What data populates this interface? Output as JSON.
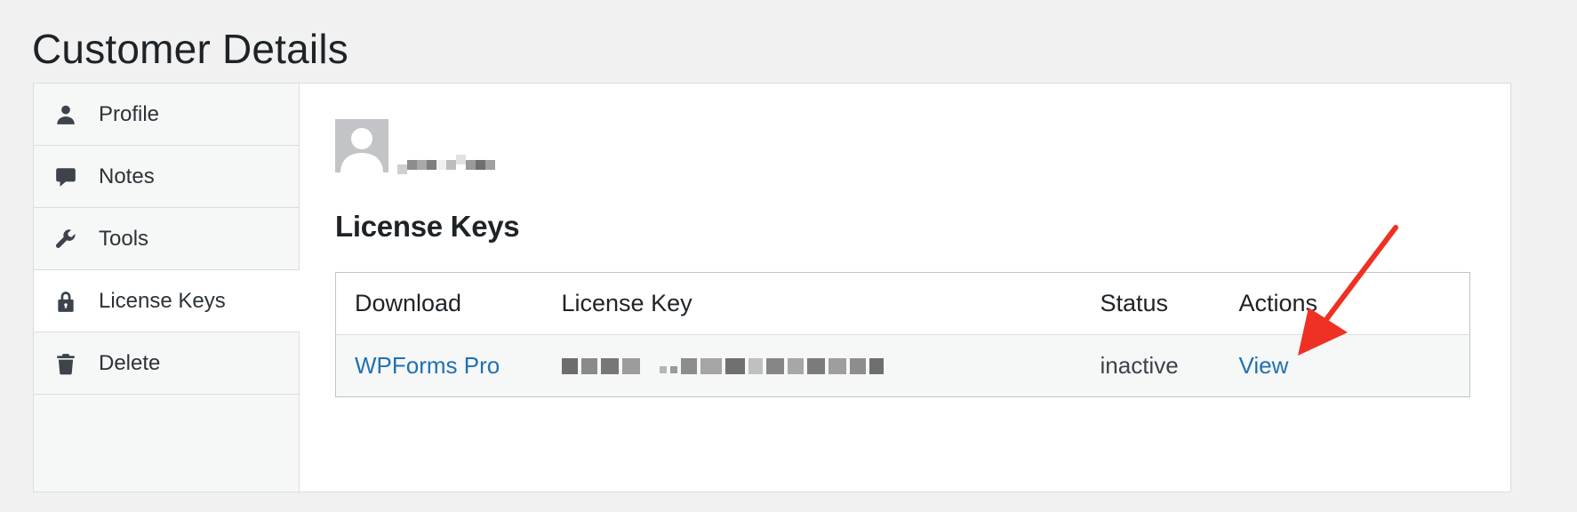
{
  "page": {
    "title": "Customer Details"
  },
  "sidebar": {
    "items": [
      {
        "label": "Profile",
        "icon": "user-icon",
        "active": false
      },
      {
        "label": "Notes",
        "icon": "speech-bubble-icon",
        "active": false
      },
      {
        "label": "Tools",
        "icon": "wrench-icon",
        "active": false
      },
      {
        "label": "License Keys",
        "icon": "lock-icon",
        "active": true
      },
      {
        "label": "Delete",
        "icon": "trash-icon",
        "active": false
      }
    ]
  },
  "main": {
    "section_title": "License Keys",
    "table": {
      "headers": [
        "Download",
        "License Key",
        "Status",
        "Actions"
      ],
      "rows": [
        {
          "download": "WPForms Pro",
          "status": "inactive",
          "action": "View"
        }
      ]
    }
  },
  "colors": {
    "link": "#2271b1",
    "annotation_arrow": "#ee3124",
    "sidebar_bg": "#f6f7f7",
    "page_bg": "#f1f1f1"
  }
}
